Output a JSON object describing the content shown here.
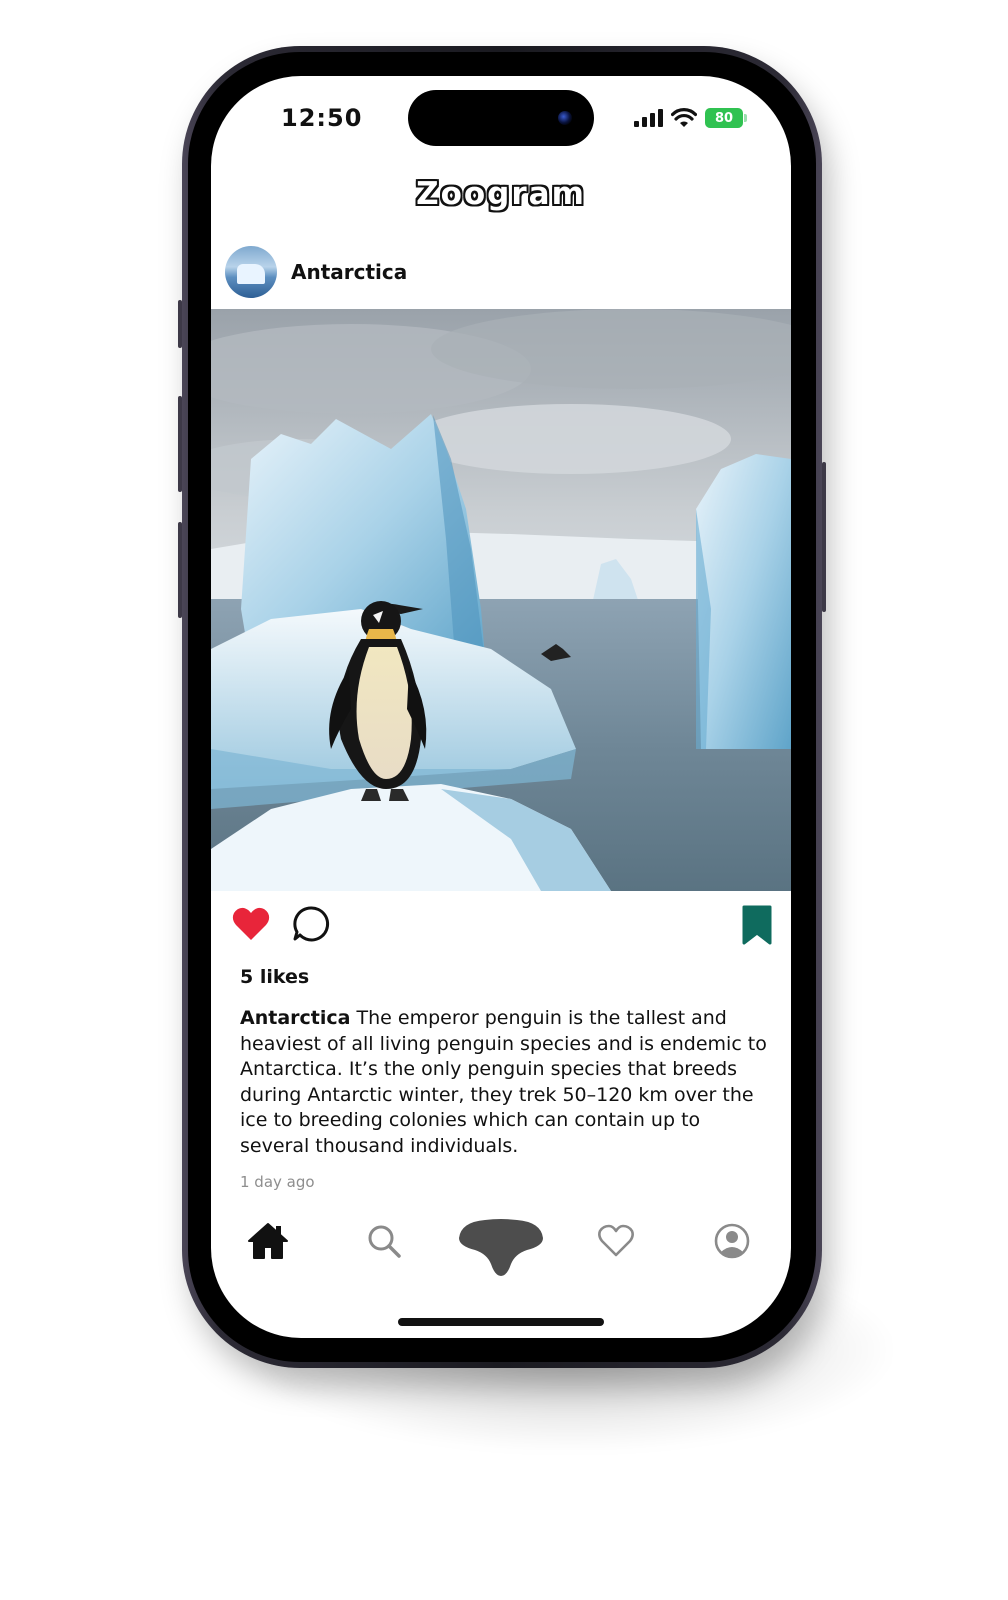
{
  "status_bar": {
    "time": "12:50",
    "battery": "80"
  },
  "app": {
    "logo": "Zoogram",
    "accent_color": "#0f6b5e",
    "like_color": "#e8253a"
  },
  "post": {
    "username": "Antarctica",
    "likes": "5 likes",
    "caption_user": "Antarctica",
    "caption_text": "The emperor penguin is the tallest and heaviest of all living penguin species and is endemic to Antarctica. It’s the only penguin species that breeds during Antarctic winter, they trek 50–120 km over the ice to breeding colonies which can contain up to several thousand individuals.",
    "timestamp": "1 day ago",
    "liked": true,
    "saved": true
  },
  "icons": {
    "like": "heart-filled-icon",
    "comment": "comment-bubble-icon",
    "save": "bookmark-filled-icon",
    "tabs": [
      "home-icon",
      "search-icon",
      "nose-icon",
      "heart-icon",
      "profile-icon"
    ]
  }
}
